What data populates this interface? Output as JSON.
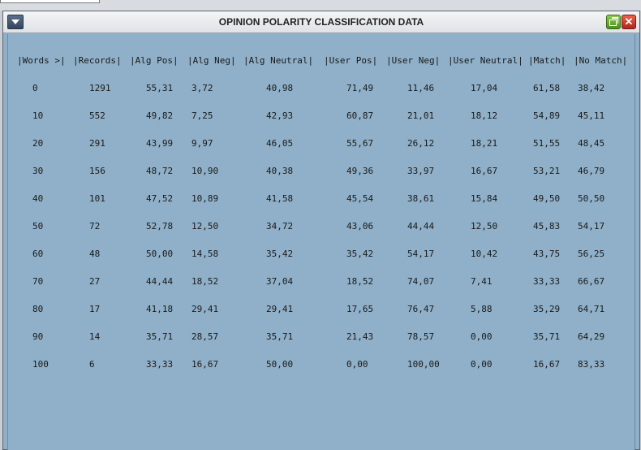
{
  "window": {
    "title": "OPINION POLARITY CLASSIFICATION DATA",
    "close_glyph": "✕"
  },
  "table": {
    "headers": [
      "|Words >|",
      "|Records|",
      "|Alg Pos|",
      "|Alg Neg|",
      "|Alg Neutral|",
      "|User Pos|",
      "|User Neg|",
      "|User Neutral|",
      "|Match|",
      "|No Match|"
    ],
    "rows": [
      [
        "0",
        "1291",
        "55,31",
        "3,72",
        "40,98",
        "71,49",
        "11,46",
        "17,04",
        "61,58",
        "38,42"
      ],
      [
        "10",
        "552",
        "49,82",
        "7,25",
        "42,93",
        "60,87",
        "21,01",
        "18,12",
        "54,89",
        "45,11"
      ],
      [
        "20",
        "291",
        "43,99",
        "9,97",
        "46,05",
        "55,67",
        "26,12",
        "18,21",
        "51,55",
        "48,45"
      ],
      [
        "30",
        "156",
        "48,72",
        "10,90",
        "40,38",
        "49,36",
        "33,97",
        "16,67",
        "53,21",
        "46,79"
      ],
      [
        "40",
        "101",
        "47,52",
        "10,89",
        "41,58",
        "45,54",
        "38,61",
        "15,84",
        "49,50",
        "50,50"
      ],
      [
        "50",
        "72",
        "52,78",
        "12,50",
        "34,72",
        "43,06",
        "44,44",
        "12,50",
        "45,83",
        "54,17"
      ],
      [
        "60",
        "48",
        "50,00",
        "14,58",
        "35,42",
        "35,42",
        "54,17",
        "10,42",
        "43,75",
        "56,25"
      ],
      [
        "70",
        "27",
        "44,44",
        "18,52",
        "37,04",
        "18,52",
        "74,07",
        "7,41",
        "33,33",
        "66,67"
      ],
      [
        "80",
        "17",
        "41,18",
        "29,41",
        "29,41",
        "17,65",
        "76,47",
        "5,88",
        "35,29",
        "64,71"
      ],
      [
        "90",
        "14",
        "35,71",
        "28,57",
        "35,71",
        "21,43",
        "78,57",
        "0,00",
        "35,71",
        "64,29"
      ],
      [
        "100",
        "6",
        "33,33",
        "16,67",
        "50,00",
        "0,00",
        "100,00",
        "0,00",
        "16,67",
        "83,33"
      ]
    ]
  }
}
